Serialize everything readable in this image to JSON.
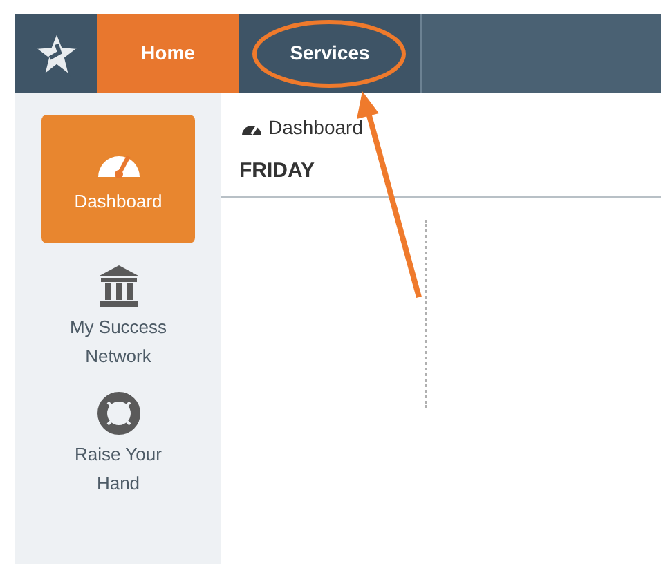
{
  "nav": {
    "tabs": [
      {
        "label": "Home",
        "selected": true
      },
      {
        "label": "Services",
        "selected": false
      }
    ]
  },
  "sidebar": {
    "items": [
      {
        "label": "Dashboard",
        "kind": "gauge",
        "selected": true
      },
      {
        "label": "My Success Network",
        "kind": "bank",
        "selected": false
      },
      {
        "label": "Raise Your Hand",
        "kind": "lifebuoy",
        "selected": false
      }
    ]
  },
  "main": {
    "breadcrumb": "Dashboard",
    "heading": "FRIDAY"
  }
}
